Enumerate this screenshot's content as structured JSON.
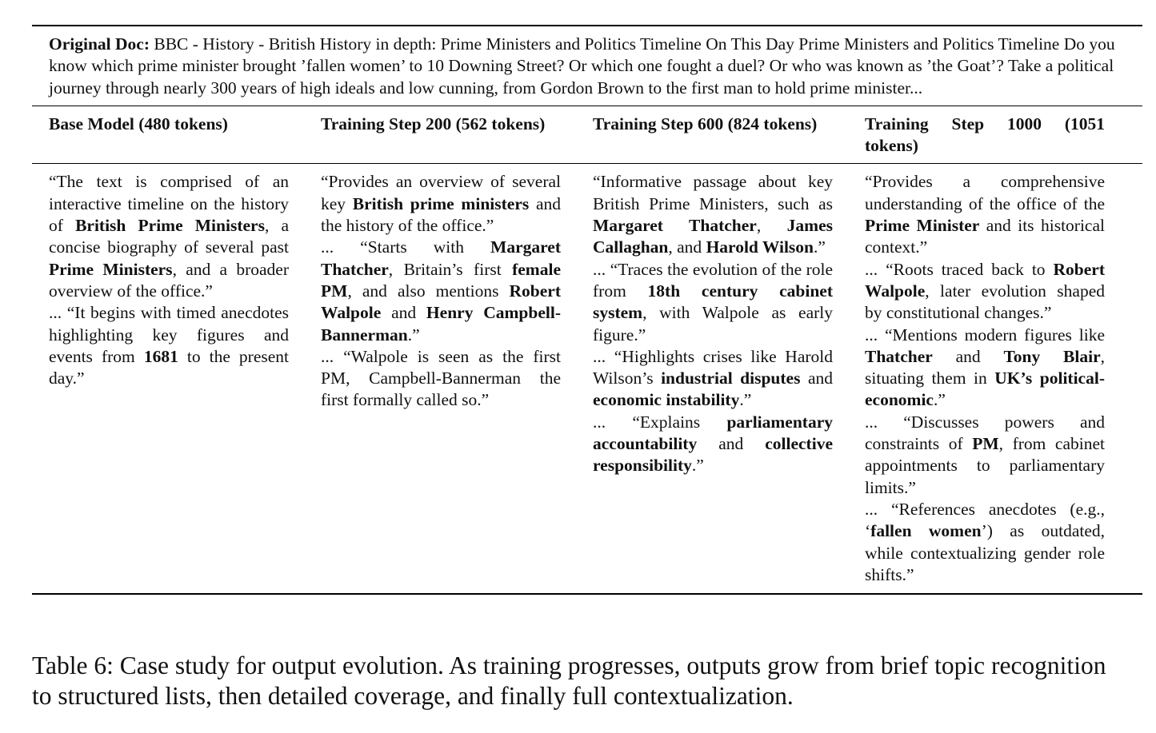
{
  "original_doc": {
    "label": "Original Doc:",
    "text": " BBC - History - British History in depth: Prime Ministers and Politics Timeline On This Day Prime Ministers and Politics Timeline Do you know which prime minister brought ’fallen women’ to 10 Downing Street? Or which one fought a duel? Or who was known as ’the Goat’? Take a political journey through nearly 300 years of high ideals and low cunning, from Gordon Brown to the first man to hold prime minister..."
  },
  "columns": [
    {
      "header": "Base Model (480 tokens)",
      "paragraphs": [
        [
          {
            "t": "“The text is comprised of an interactive timeline on the history of "
          },
          {
            "t": "British Prime Ministers",
            "b": true
          },
          {
            "t": ", a concise biography of several past "
          },
          {
            "t": "Prime Ministers",
            "b": true
          },
          {
            "t": ", and a broader overview of the office.”"
          }
        ],
        [
          {
            "t": "... “It begins with timed anecdotes highlighting key figures and events from "
          },
          {
            "t": "1681",
            "b": true
          },
          {
            "t": " to the present day.”"
          }
        ]
      ]
    },
    {
      "header": "Training Step 200 (562 tokens)",
      "paragraphs": [
        [
          {
            "t": "“Provides an overview of several key "
          },
          {
            "t": "British prime ministers",
            "b": true
          },
          {
            "t": " and the history of the office.”"
          }
        ],
        [
          {
            "t": "... “Starts with "
          },
          {
            "t": "Margaret Thatcher",
            "b": true
          },
          {
            "t": ", Britain’s first "
          },
          {
            "t": "female PM",
            "b": true
          },
          {
            "t": ", and also mentions "
          },
          {
            "t": "Robert Walpole",
            "b": true
          },
          {
            "t": " and "
          },
          {
            "t": "Henry Campbell-Bannerman",
            "b": true
          },
          {
            "t": ".”"
          }
        ],
        [
          {
            "t": "... “Walpole is seen as the first PM, Campbell-Bannerman the first formally called so.”"
          }
        ]
      ]
    },
    {
      "header": "Training Step 600 (824 tokens)",
      "paragraphs": [
        [
          {
            "t": "“Informative passage about key British Prime Ministers, such as "
          },
          {
            "t": "Margaret Thatcher",
            "b": true
          },
          {
            "t": ", "
          },
          {
            "t": "James Callaghan",
            "b": true
          },
          {
            "t": ", and "
          },
          {
            "t": "Harold Wilson",
            "b": true
          },
          {
            "t": ".”"
          }
        ],
        [
          {
            "t": "... “Traces the evolution of the role from "
          },
          {
            "t": "18th century cabinet system",
            "b": true
          },
          {
            "t": ", with Walpole as early figure.”"
          }
        ],
        [
          {
            "t": "... “Highlights crises like Harold Wilson’s "
          },
          {
            "t": "industrial disputes",
            "b": true
          },
          {
            "t": " and "
          },
          {
            "t": "economic instability",
            "b": true
          },
          {
            "t": ".”"
          }
        ],
        [
          {
            "t": "... “Explains "
          },
          {
            "t": "parliamentary accountability",
            "b": true
          },
          {
            "t": " and "
          },
          {
            "t": "collective responsibility",
            "b": true
          },
          {
            "t": ".”"
          }
        ]
      ]
    },
    {
      "header": "Training Step 1000 (1051 tokens)",
      "paragraphs": [
        [
          {
            "t": "“Provides a comprehensive understanding of the office of the "
          },
          {
            "t": "Prime Minister",
            "b": true
          },
          {
            "t": " and its historical context.”"
          }
        ],
        [
          {
            "t": "... “Roots traced back to "
          },
          {
            "t": "Robert Walpole",
            "b": true
          },
          {
            "t": ", later evolution shaped by constitutional changes.”"
          }
        ],
        [
          {
            "t": "... “Mentions modern figures like "
          },
          {
            "t": "Thatcher",
            "b": true
          },
          {
            "t": " and "
          },
          {
            "t": "Tony Blair",
            "b": true
          },
          {
            "t": ", situating them in "
          },
          {
            "t": "UK’s political-economic",
            "b": true
          },
          {
            "t": ".”"
          }
        ],
        [
          {
            "t": "... “Discusses powers and constraints of "
          },
          {
            "t": "PM",
            "b": true
          },
          {
            "t": ", from cabinet appointments to parliamentary limits.”"
          }
        ],
        [
          {
            "t": "... “References anecdotes (e.g., ‘"
          },
          {
            "t": "fallen women",
            "b": true
          },
          {
            "t": "’) as outdated, while contextualizing gender role shifts.”"
          }
        ]
      ]
    }
  ],
  "caption": "Table 6: Case study for output evolution. As training progresses, outputs grow from brief topic recognition to structured lists, then detailed coverage, and finally full contextualization."
}
